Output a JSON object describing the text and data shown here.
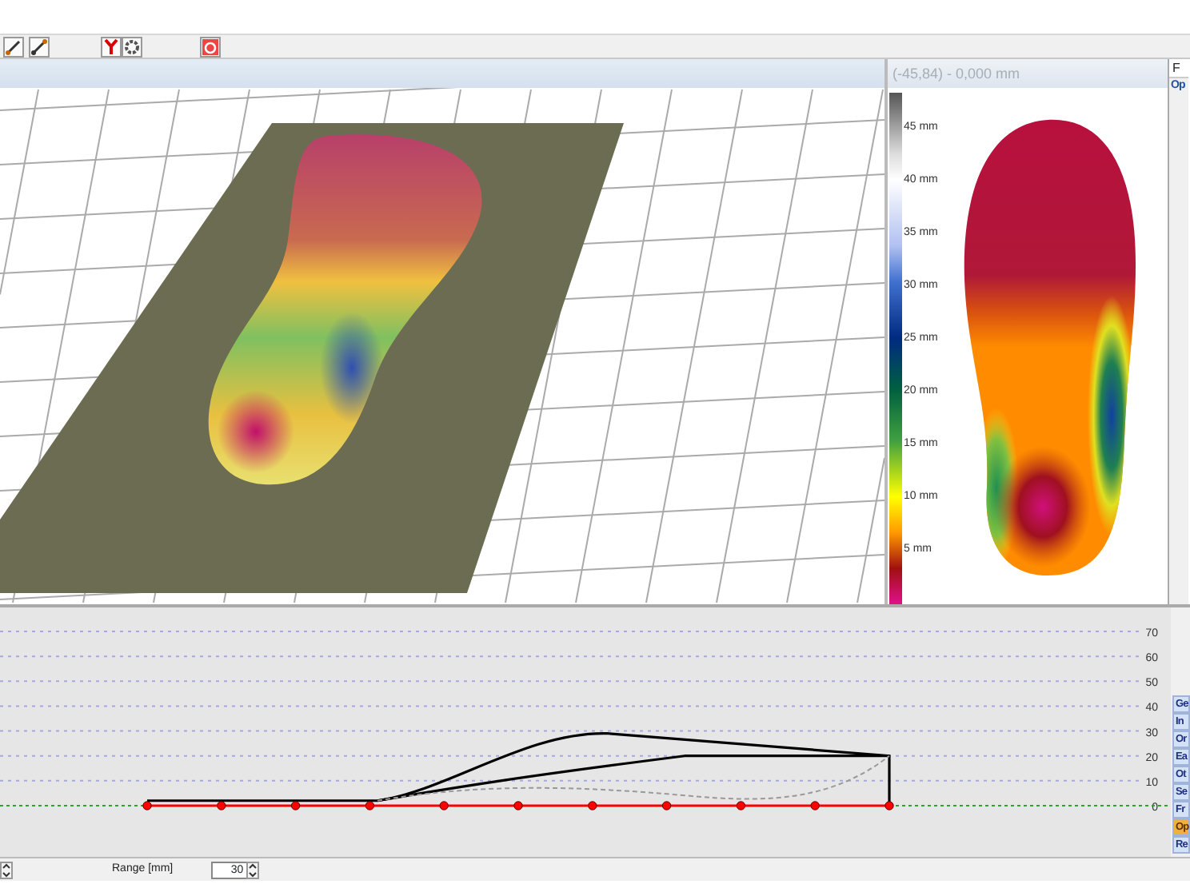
{
  "color_map": {
    "range": "(-45,84) - 0,000 mm",
    "scale_labels": [
      "45 mm",
      "40 mm",
      "35 mm",
      "30 mm",
      "25 mm",
      "20 mm",
      "15 mm",
      "10 mm",
      "5 mm"
    ]
  },
  "side_panel": {
    "tab_label": "F",
    "section_label": "Op"
  },
  "profile": {
    "tick_labels": [
      "70",
      "60",
      "50",
      "40",
      "30",
      "20",
      "10",
      "0"
    ]
  },
  "side_tabs": [
    {
      "label": "Ge",
      "selected": false
    },
    {
      "label": "In",
      "selected": false
    },
    {
      "label": "Or",
      "selected": false
    },
    {
      "label": "Ea",
      "selected": false
    },
    {
      "label": "Ot",
      "selected": false
    },
    {
      "label": "Se",
      "selected": false
    },
    {
      "label": "Fr",
      "selected": false
    },
    {
      "label": "Op",
      "selected": true
    },
    {
      "label": "Re",
      "selected": false
    }
  ],
  "bottom_bar": {
    "range_label": "Range [mm]",
    "range_value": "30"
  }
}
